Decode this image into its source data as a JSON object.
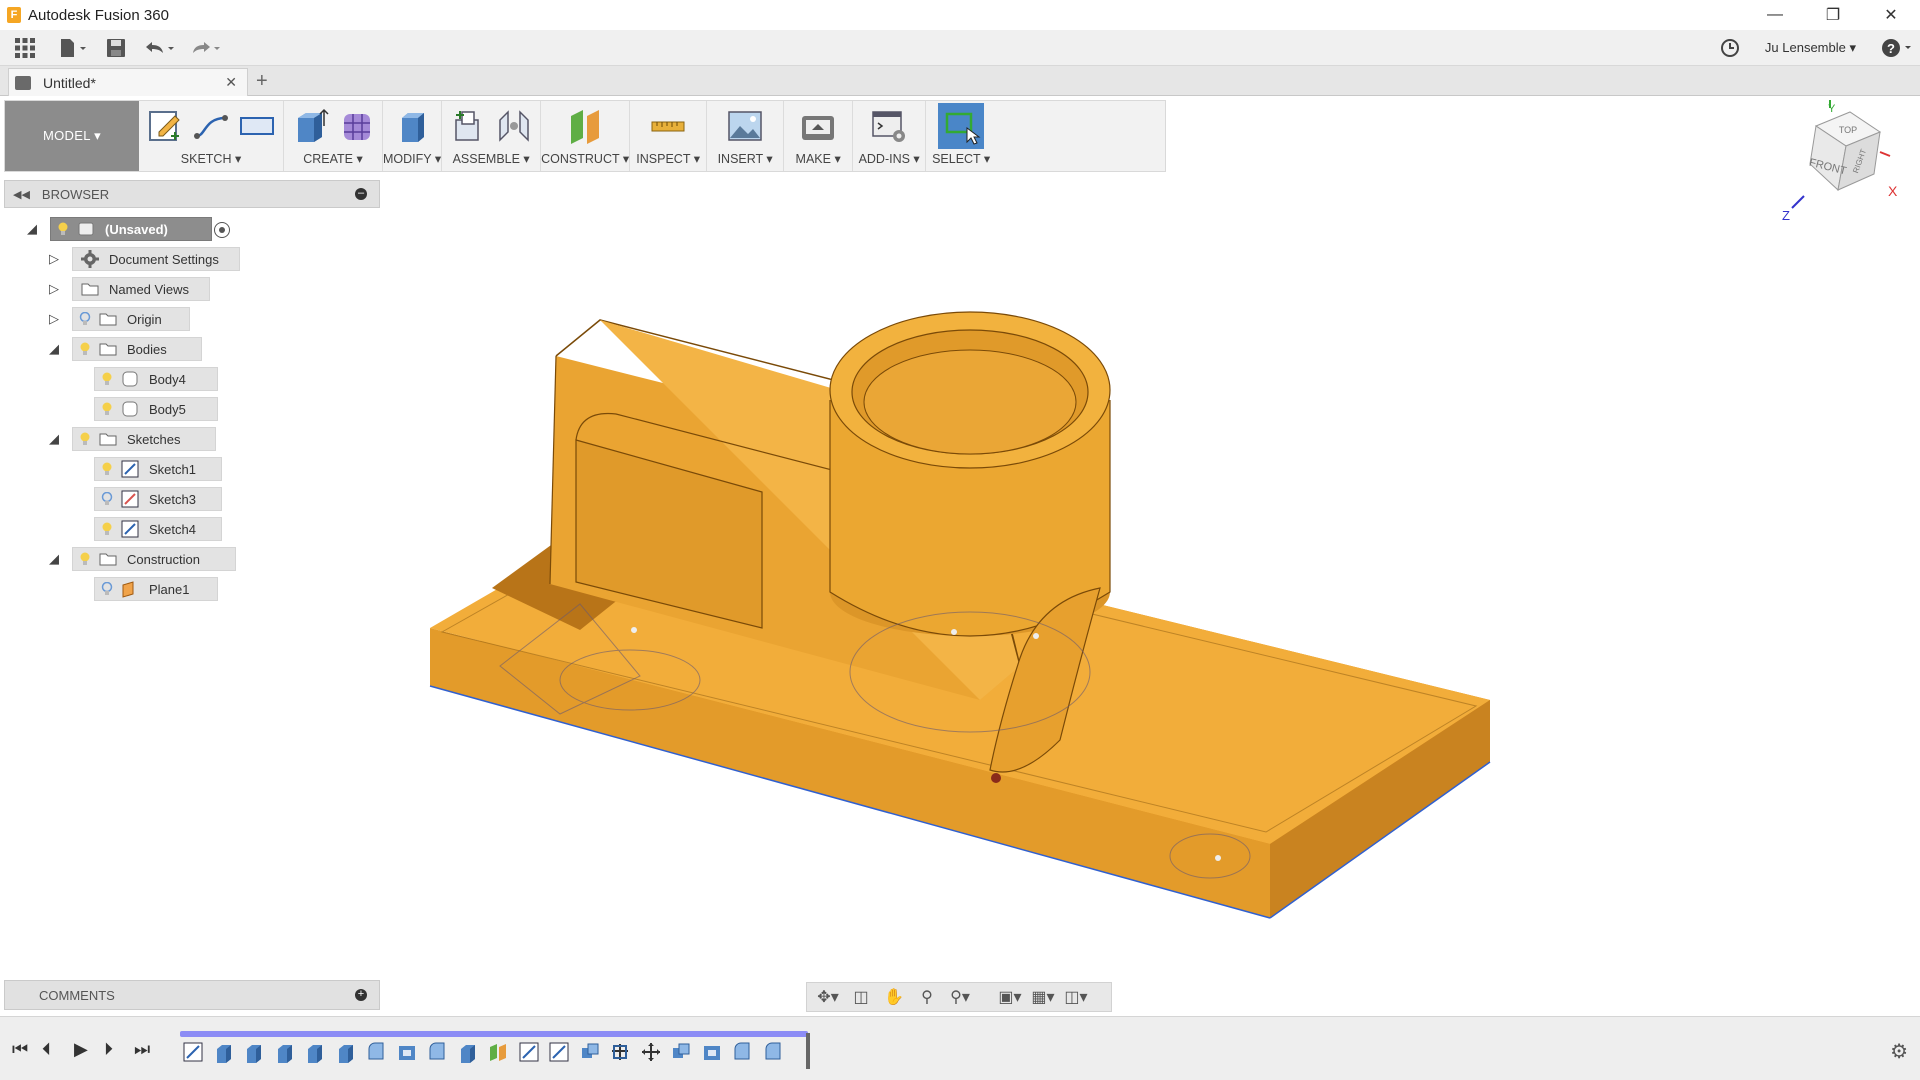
{
  "window": {
    "title": "Autodesk Fusion 360",
    "app_icon": "F"
  },
  "user": {
    "name": "Ju Lensemble"
  },
  "tab": {
    "name": "Untitled*"
  },
  "ribbon": {
    "workspace": "MODEL ▾",
    "groups": [
      {
        "label": "SKETCH ▾"
      },
      {
        "label": "CREATE ▾"
      },
      {
        "label": "MODIFY ▾"
      },
      {
        "label": "ASSEMBLE ▾"
      },
      {
        "label": "CONSTRUCT ▾"
      },
      {
        "label": "INSPECT ▾"
      },
      {
        "label": "INSERT ▾"
      },
      {
        "label": "MAKE ▾"
      },
      {
        "label": "ADD-INS ▾"
      },
      {
        "label": "SELECT ▾"
      }
    ]
  },
  "browser": {
    "title": "BROWSER",
    "items": [
      {
        "label": "(Unsaved)"
      },
      {
        "label": "Document Settings"
      },
      {
        "label": "Named Views"
      },
      {
        "label": "Origin"
      },
      {
        "label": "Bodies"
      },
      {
        "label": "Body4"
      },
      {
        "label": "Body5"
      },
      {
        "label": "Sketches"
      },
      {
        "label": "Sketch1"
      },
      {
        "label": "Sketch3"
      },
      {
        "label": "Sketch4"
      },
      {
        "label": "Construction"
      },
      {
        "label": "Plane1"
      }
    ]
  },
  "comments": {
    "title": "COMMENTS"
  },
  "viewcube": {
    "top": "TOP",
    "front": "FRONT",
    "right": "RIGHT",
    "x": "X",
    "y": "Y",
    "z": "Z"
  },
  "colors": {
    "model": "#f0a830",
    "ribbon_active": "#4a86c8",
    "timeline": "#8c8cf5"
  }
}
